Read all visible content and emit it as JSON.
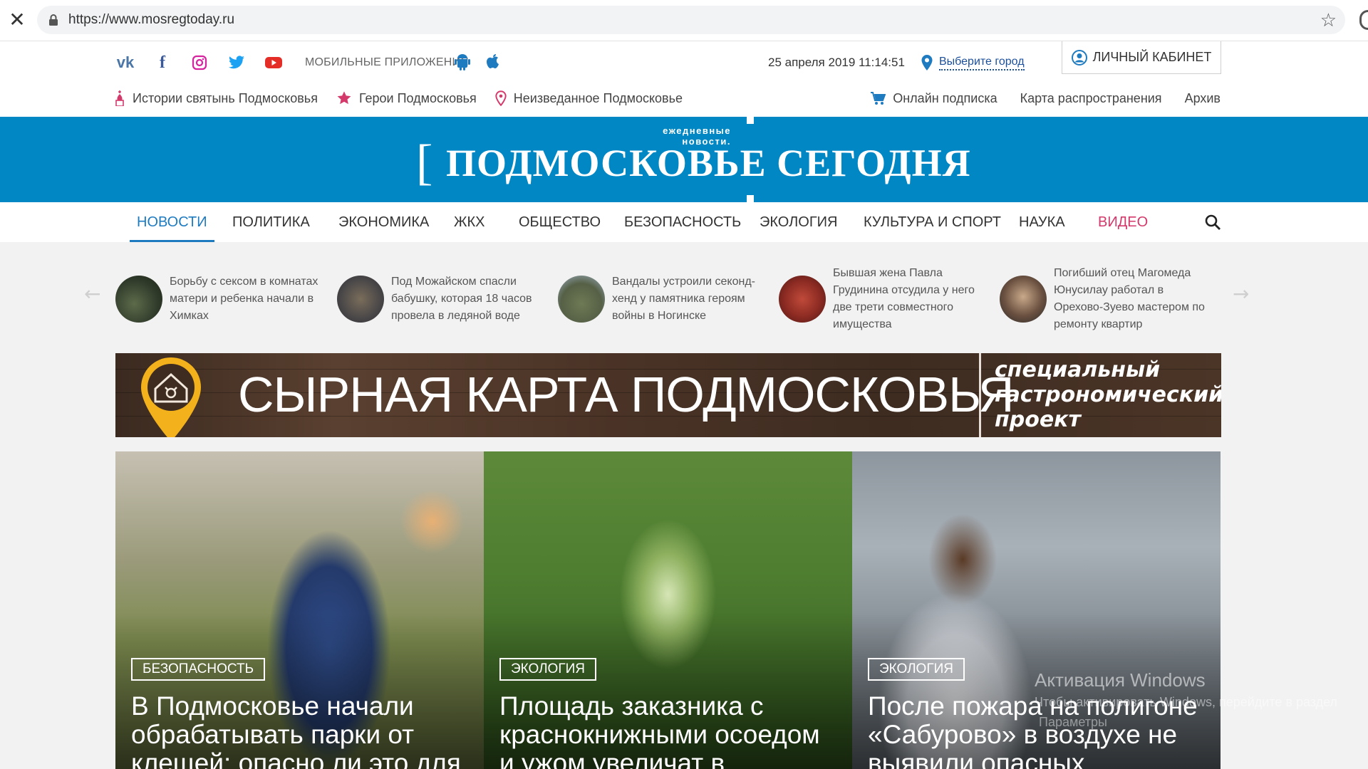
{
  "browser": {
    "url": "https://www.mosregtoday.ru"
  },
  "topbar": {
    "apps_label": "МОБИЛЬНЫЕ ПРИЛОЖЕНИЯ",
    "datetime": "25 апреля 2019  11:14:51",
    "city_label": "Выберите город",
    "cabinet_label": "ЛИЧНЫЙ КАБИНЕТ",
    "social": [
      "vk-icon",
      "facebook-icon",
      "instagram-icon",
      "twitter-icon",
      "youtube-icon"
    ]
  },
  "links": {
    "left": [
      "Истории святынь Подмосковья",
      "Герои Подмосковья",
      "Неизведанное Подмосковье"
    ],
    "right": [
      "Онлайн подписка",
      "Карта распространения",
      "Архив"
    ]
  },
  "logo": {
    "tagline": "ежедневные новости.",
    "title": "ПОДМОСКОВЬЕ СЕГОДНЯ",
    "bracket": "["
  },
  "nav": {
    "items": [
      "НОВОСТИ",
      "ПОЛИТИКА",
      "ЭКОНОМИКА",
      "ЖКХ",
      "ОБЩЕСТВО",
      "БЕЗОПАСНОСТЬ",
      "ЭКОЛОГИЯ",
      "КУЛЬТУРА И СПОРТ",
      "НАУКА",
      "ВИДЕО"
    ],
    "active": "НОВОСТИ"
  },
  "strip": {
    "items": [
      "Борьбу с сексом в комнатах матери и ребенка начали в Химках",
      "Под Можайском спасли бабушку, которая 18 часов провела в ледяной воде",
      "Вандалы устроили секонд-хенд у памятника героям войны в Ногинске",
      "Бывшая жена Павла Грудинина отсудила у него две трети совместного имущества",
      "Погибший отец Магомеда Юнусилау работал в Орехово-Зуево мастером по ремонту квартир"
    ]
  },
  "ad": {
    "title": "СЫРНАЯ КАРТА ПОДМОСКОВЬЯ",
    "subtitle": "специальный гастрономический проект"
  },
  "cards": [
    {
      "tag": "БЕЗОПАСНОСТЬ",
      "headline": "В Подмосковье начали обрабатывать парки от клещей: опасно ли это для"
    },
    {
      "tag": "ЭКОЛОГИЯ",
      "headline": "Площадь заказника с краснокнижными осоедом и ужом увеличат в"
    },
    {
      "tag": "ЭКОЛОГИЯ",
      "headline": "После пожара на полигоне «Сабурово» в воздухе не выявили опасных примесей"
    }
  ],
  "watermark": {
    "title": "Активация Windows",
    "line2": "Чтобы активировать Windows, перейдите в раздел",
    "line3": "Параметры"
  },
  "colors": {
    "brand_blue": "#0087c4",
    "nav_active": "#1f7bc0",
    "video_pink": "#d33a6b"
  }
}
